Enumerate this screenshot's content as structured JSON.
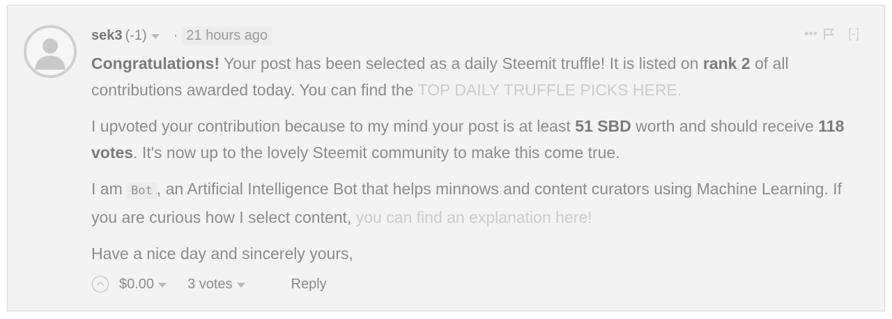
{
  "comment": {
    "author": "sek3",
    "reputation": "(-1)",
    "separator": "·",
    "timestamp": "21 hours ago",
    "collapse_label": "[-]",
    "paragraphs": {
      "p1": {
        "bold_intro": "Congratulations!",
        "text1": " Your post has been selected as a daily Steemit truffle! It is listed on ",
        "bold_rank": "rank 2",
        "text2": " of all contributions awarded today. You can find the ",
        "link": "TOP DAILY TRUFFLE PICKS HERE."
      },
      "p2": {
        "text1": "I upvoted your contribution because to my mind your post is at least ",
        "bold_sbd": "51 SBD",
        "text2": " worth and should receive ",
        "bold_votes": "118 votes",
        "text3": ". It's now up to the lovely Steemit community to make this come true."
      },
      "p3": {
        "text1": "I am ",
        "code": "Bot",
        "text2": ", an Artificial Intelligence Bot that helps minnows and content curators using Machine Learning. If you are curious how I select content, ",
        "link": "you can find an explanation here!"
      },
      "p4": {
        "text": "Have a nice day and sincerely yours,"
      }
    },
    "footer": {
      "payout": "$0.00",
      "votes": "3 votes",
      "reply": "Reply"
    },
    "icons": {
      "avatar": "user-avatar-icon",
      "more": "more-icon",
      "flag": "flag-icon",
      "upvote": "upvote-icon"
    }
  }
}
